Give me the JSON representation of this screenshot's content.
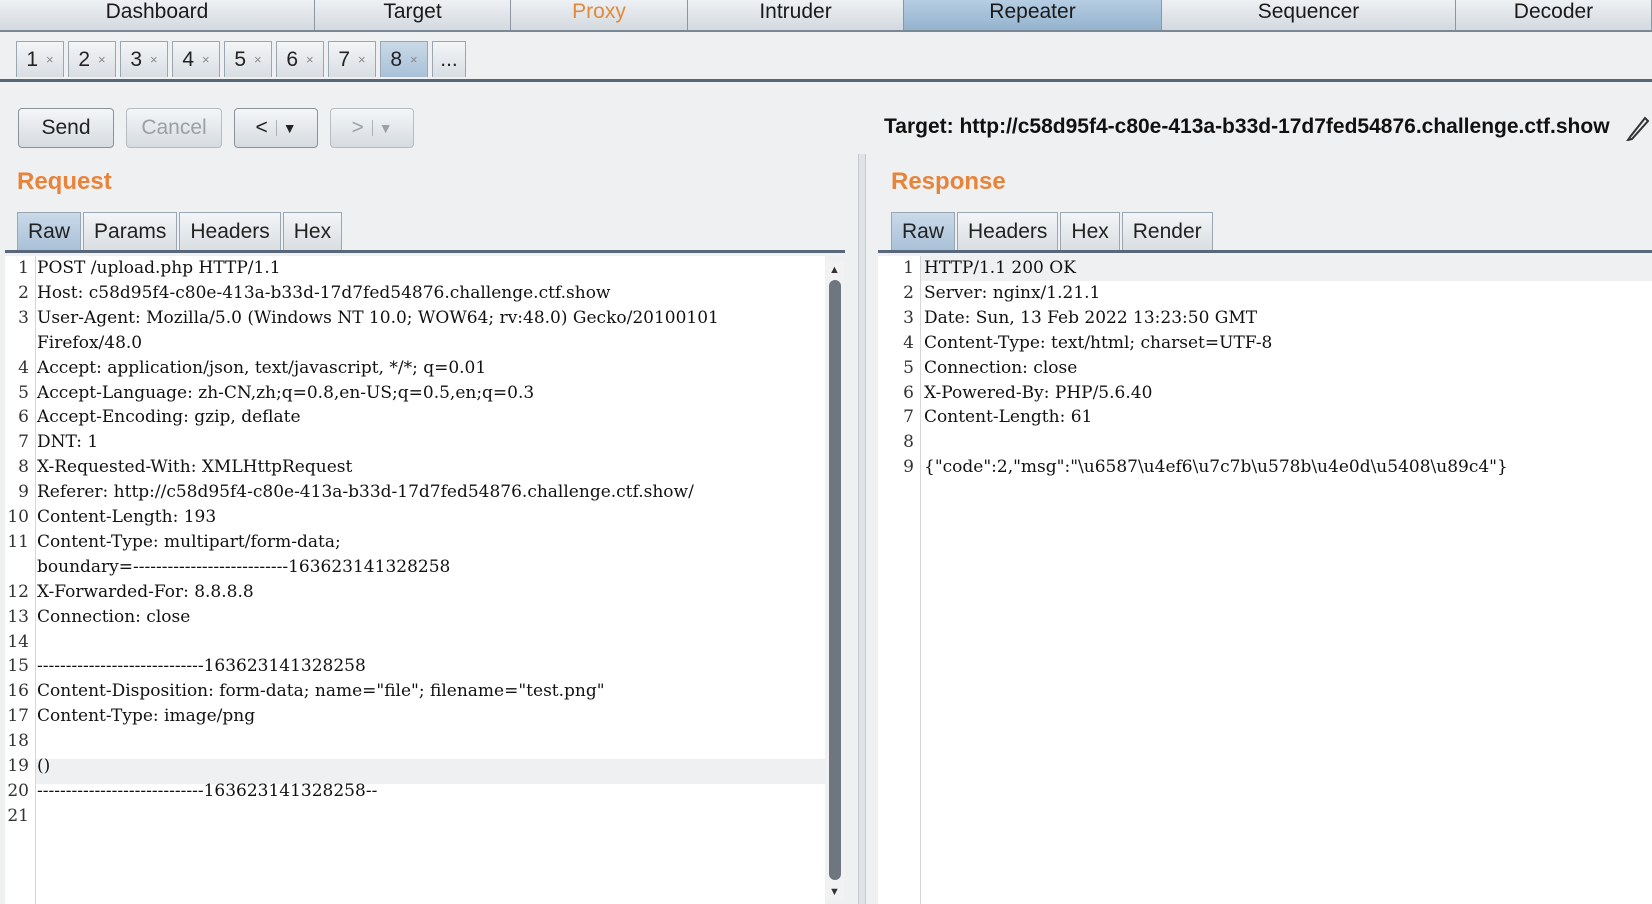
{
  "tool_tabs": [
    {
      "label": "Dashboard",
      "state": "normal"
    },
    {
      "label": "Target",
      "state": "normal"
    },
    {
      "label": "Proxy",
      "state": "highlight"
    },
    {
      "label": "Intruder",
      "state": "normal"
    },
    {
      "label": "Repeater",
      "state": "active"
    },
    {
      "label": "Sequencer",
      "state": "normal"
    },
    {
      "label": "Decoder",
      "state": "normal"
    }
  ],
  "repeater_tabs": [
    "1",
    "2",
    "3",
    "4",
    "5",
    "6",
    "7",
    "8"
  ],
  "repeater_tabs_active": "8",
  "repeater_more": "...",
  "toolbar": {
    "send_label": "Send",
    "cancel_label": "Cancel",
    "back_label": "<",
    "forward_label": ">",
    "dropdown_glyph": "▼",
    "target": "Target: http://c58d95f4-c80e-413a-b33d-17d7fed54876.challenge.ctf.show",
    "edit_icon": "pencil-icon"
  },
  "request": {
    "title": "Request",
    "tabs": [
      "Raw",
      "Params",
      "Headers",
      "Hex"
    ],
    "active_tab": "Raw",
    "line_numbers": [
      "1",
      "2",
      "3",
      "",
      "4",
      "5",
      "6",
      "7",
      "8",
      "9",
      "10",
      "11",
      "",
      "12",
      "13",
      "14",
      "15",
      "16",
      "17",
      "18",
      "19",
      "20",
      "21"
    ],
    "lines": [
      "POST /upload.php HTTP/1.1",
      "Host: c58d95f4-c80e-413a-b33d-17d7fed54876.challenge.ctf.show",
      "User-Agent: Mozilla/5.0 (Windows NT 10.0; WOW64; rv:48.0) Gecko/20100101",
      "Firefox/48.0",
      "Accept: application/json, text/javascript, */*; q=0.01",
      "Accept-Language: zh-CN,zh;q=0.8,en-US;q=0.5,en;q=0.3",
      "Accept-Encoding: gzip, deflate",
      "DNT: 1",
      "X-Requested-With: XMLHttpRequest",
      "Referer: http://c58d95f4-c80e-413a-b33d-17d7fed54876.challenge.ctf.show/",
      "Content-Length: 193",
      "Content-Type: multipart/form-data;",
      "boundary=---------------------------163623141328258",
      "X-Forwarded-For: 8.8.8.8",
      "Connection: close",
      "",
      "-----------------------------163623141328258",
      "Content-Disposition: form-data; name=\"file\"; filename=\"test.png\"",
      "Content-Type: image/png",
      "",
      "()",
      "-----------------------------163623141328258--",
      ""
    ]
  },
  "response": {
    "title": "Response",
    "tabs": [
      "Raw",
      "Headers",
      "Hex",
      "Render"
    ],
    "active_tab": "Raw",
    "line_numbers": [
      "1",
      "2",
      "3",
      "4",
      "5",
      "6",
      "7",
      "8",
      "9"
    ],
    "lines": [
      "HTTP/1.1 200 OK",
      "Server: nginx/1.21.1",
      "Date: Sun, 13 Feb 2022 13:23:50 GMT",
      "Content-Type: text/html; charset=UTF-8",
      "Connection: close",
      "X-Powered-By: PHP/5.6.40",
      "Content-Length: 61",
      "",
      "{\"code\":2,\"msg\":\"\\u6587\\u4ef6\\u7c7b\\u578b\\u4e0d\\u5408\\u89c4\"}"
    ]
  },
  "colors": {
    "accent": "#e8843a",
    "active_tab": "#a9c1d8"
  }
}
